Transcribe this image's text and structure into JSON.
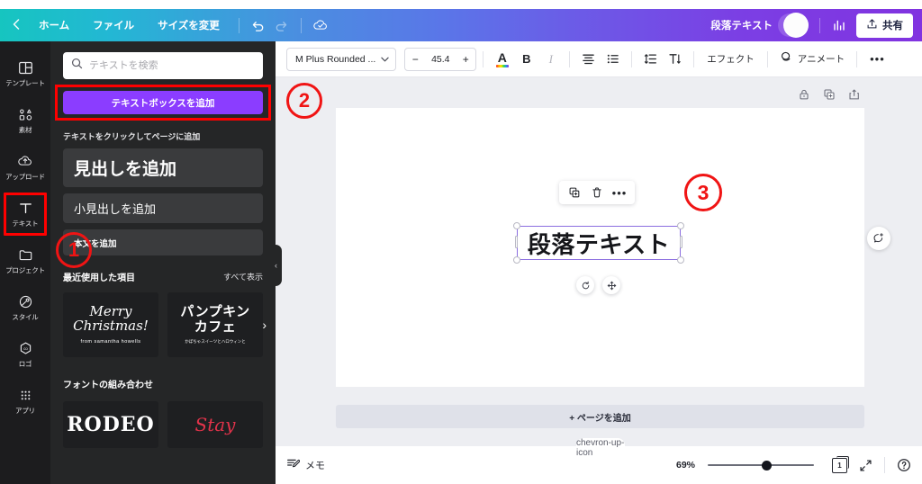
{
  "topbar": {
    "back_icon": "chevron-left-icon",
    "items": [
      {
        "label": "ホーム",
        "name": "home"
      },
      {
        "label": "ファイル",
        "name": "file"
      },
      {
        "label": "サイズを変更",
        "name": "resize"
      }
    ],
    "undo_icon": "undo-icon",
    "redo_icon": "redo-icon",
    "cloud_icon": "cloud-saved-icon",
    "doc_name": "段落テキスト",
    "plus_label": "+",
    "chart_icon": "insights-icon",
    "share_label": "共有",
    "share_icon": "upload-icon"
  },
  "rail": {
    "items": [
      {
        "label": "テンプレート",
        "icon": "templates-icon",
        "active": false
      },
      {
        "label": "素材",
        "icon": "elements-icon",
        "active": false
      },
      {
        "label": "アップロード",
        "icon": "upload-cloud-icon",
        "active": false
      },
      {
        "label": "テキスト",
        "icon": "text-icon",
        "active": true
      },
      {
        "label": "プロジェクト",
        "icon": "projects-folder-icon",
        "active": false
      },
      {
        "label": "スタイル",
        "icon": "styles-palette-icon",
        "active": false
      },
      {
        "label": "ロゴ",
        "icon": "logo-icon",
        "active": false
      },
      {
        "label": "アプリ",
        "icon": "apps-grid-icon",
        "active": false
      }
    ]
  },
  "panel": {
    "search_placeholder": "テキストを検索",
    "search_value": "",
    "search_icon": "search-icon",
    "add_textbox_label": "テキストボックスを追加",
    "caption": "テキストをクリックしてページに追加",
    "text_styles": [
      {
        "label": "見出しを追加",
        "name": "heading"
      },
      {
        "label": "小見出しを追加",
        "name": "subheading"
      },
      {
        "label": "本文を追加",
        "name": "body"
      }
    ],
    "recent_title": "最近使用した項目",
    "see_all_label": "すべて表示",
    "recent_items": [
      {
        "line1": "Merry",
        "line2": "Christmas!",
        "sub": "from samantha howells"
      },
      {
        "line1": "パンプキン",
        "line2": "カフェ",
        "sub": "かぼちゃスイーツとハロウィンと"
      }
    ],
    "combos_title": "フォントの組み合わせ",
    "combos": [
      {
        "label": "RODEO"
      },
      {
        "label": "Stay"
      }
    ],
    "collapse_icon": "chevron-left-icon"
  },
  "toolbar": {
    "font_name": "M Plus Rounded ...",
    "font_caret": "chevron-down-icon",
    "size_minus": "−",
    "font_size": "45.4",
    "size_plus": "+",
    "text_color_icon": "text-color-icon",
    "bold_label": "B",
    "italic_label": "I",
    "align_icon": "align-center-icon",
    "list_icon": "bullet-list-icon",
    "spacing_icon": "line-spacing-icon",
    "vertical_text_icon": "vertical-text-icon",
    "effects_label": "エフェクト",
    "animate_label": "アニメート",
    "animate_icon": "animate-icon",
    "more_label": "•••"
  },
  "canvas": {
    "lock_icon": "lock-icon",
    "duplicate_icon": "duplicate-icon",
    "export_icon": "export-icon",
    "comment_icon": "add-comment-icon",
    "add_page_label": "+ ページを追加",
    "selected_text": "段落テキスト",
    "float_copy_icon": "copy-icon",
    "float_delete_icon": "trash-icon",
    "float_more_icon": "•••",
    "rotate_icon": "rotate-icon",
    "move_icon": "move-icon"
  },
  "bottombar": {
    "notes_label": "メモ",
    "notes_icon": "notes-icon",
    "zoom_level": "69%",
    "page_count": "1",
    "fullscreen_icon": "fullscreen-icon",
    "help_icon": "help-icon",
    "notch_icon": "chevron-up-icon"
  },
  "annotations": [
    {
      "label": "①",
      "name": "annotation-1"
    },
    {
      "label": "②",
      "name": "annotation-2"
    },
    {
      "label": "③",
      "name": "annotation-3"
    }
  ]
}
